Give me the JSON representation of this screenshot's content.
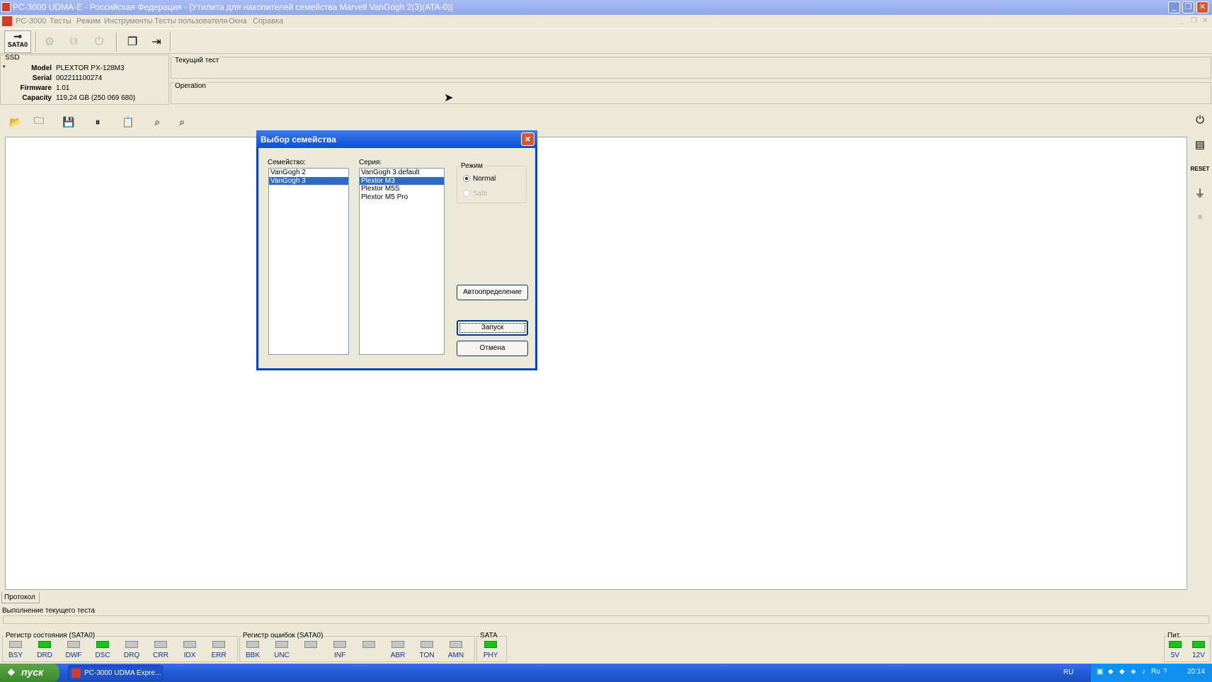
{
  "window": {
    "title": "PC-3000 UDMA-E - Российская Федерация - [Утилита для накопителей семейства Marvell VanGogh 2(3)(ATA-0)]"
  },
  "menu": [
    "PC-3000",
    "Тесты",
    "Режим",
    "Инструменты",
    "Тесты пользователя",
    "Окна",
    "Справка"
  ],
  "toolbar": {
    "sata_label": "SATA0"
  },
  "ssd": {
    "group_label": "SSD",
    "fields": [
      {
        "label": "Model",
        "value": "PLEXTOR PX-128M3"
      },
      {
        "label": "Serial",
        "value": "002211100274"
      },
      {
        "label": "Firmware",
        "value": "1.01"
      },
      {
        "label": "Capacity",
        "value": "119,24 GB (250 069 680)"
      }
    ]
  },
  "current_test": {
    "label": "Текущий тест"
  },
  "operation": {
    "label": "Operation"
  },
  "dialog": {
    "title": "Выбор семейства",
    "family_label": "Семейство:",
    "families": [
      "VanGogh 2",
      "VanGogh 3"
    ],
    "family_selected": 1,
    "series_label": "Серия:",
    "series": [
      "VanGogh 3 default",
      "Plextor M3",
      "Plextor M5S",
      "Plextor M5 Pro"
    ],
    "series_selected": 1,
    "mode_label": "Режим",
    "mode_normal": "Normal",
    "mode_safe": "Safe",
    "auto_button": "Автоопределение",
    "start_button": "Запуск",
    "cancel_button": "Отмена"
  },
  "bottom": {
    "protocol_tab": "Протокол",
    "progress_label": "Выполнение текущего теста",
    "status_reg_label": "Регистр состояния (SATA0)",
    "status_leds": [
      {
        "label": "BSY",
        "on": false
      },
      {
        "label": "DRD",
        "on": true
      },
      {
        "label": "DWF",
        "on": false
      },
      {
        "label": "DSC",
        "on": true
      },
      {
        "label": "DRQ",
        "on": false
      },
      {
        "label": "CRR",
        "on": false
      },
      {
        "label": "IDX",
        "on": false
      },
      {
        "label": "ERR",
        "on": false
      }
    ],
    "error_reg_label": "Регистр ошибок  (SATA0)",
    "error_leds": [
      {
        "label": "BBK",
        "on": false
      },
      {
        "label": "UNC",
        "on": false
      },
      {
        "label": "",
        "on": false
      },
      {
        "label": "INF",
        "on": false
      },
      {
        "label": "",
        "on": false
      },
      {
        "label": "ABR",
        "on": false
      },
      {
        "label": "TON",
        "on": false
      },
      {
        "label": "AMN",
        "on": false
      }
    ],
    "sata_label": "SATA",
    "sata_leds": [
      {
        "label": "PHY",
        "on": true
      }
    ],
    "power_label": "Пит.",
    "power_leds": [
      {
        "label": "5V",
        "on": true
      },
      {
        "label": "12V",
        "on": true
      }
    ]
  },
  "taskbar": {
    "start_label": "пуск",
    "task_label": "PC-3000 UDMA Expre...",
    "lang": "RU",
    "tray_lang": "Ru",
    "clock": "20:14"
  }
}
